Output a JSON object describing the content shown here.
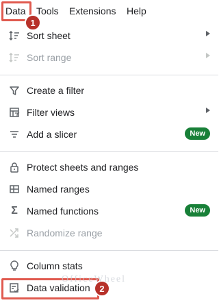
{
  "menubar": {
    "items": [
      {
        "label": "Data"
      },
      {
        "label": "Tools"
      },
      {
        "label": "Extensions"
      },
      {
        "label": "Help"
      }
    ]
  },
  "annotations": {
    "badge1": "1",
    "badge2": "2",
    "highlight_color": "#e05a4f",
    "badge_color": "#b7312a"
  },
  "menu": {
    "sort_sheet": "Sort sheet",
    "sort_range": "Sort range",
    "create_filter": "Create a filter",
    "filter_views": "Filter views",
    "add_slicer": "Add a slicer",
    "protect": "Protect sheets and ranges",
    "named_ranges": "Named ranges",
    "named_functions": "Named functions",
    "randomize": "Randomize range",
    "column_stats": "Column stats",
    "data_validation": "Data validation",
    "new_badge": "New"
  },
  "watermark": "OfficeWheel",
  "colors": {
    "new_badge": "#188038",
    "disabled_text": "#9aa0a6",
    "icon": "#5f6368"
  }
}
